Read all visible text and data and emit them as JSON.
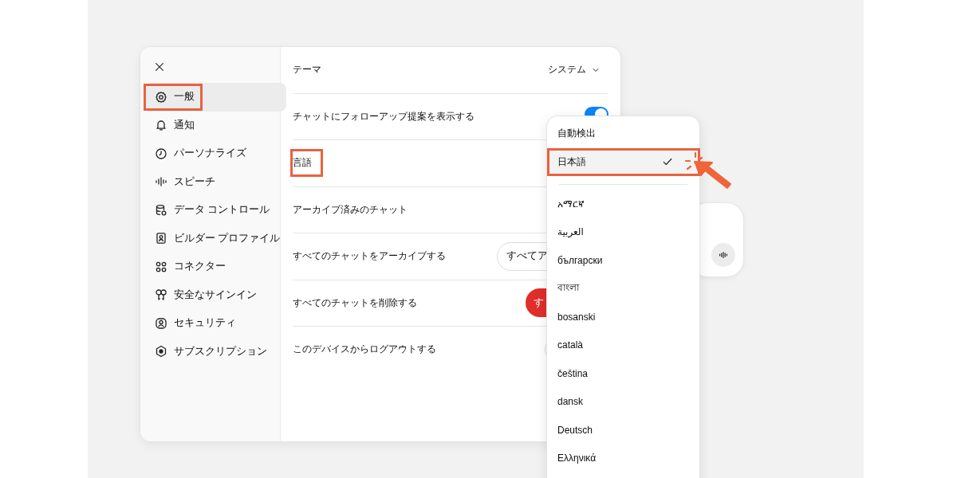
{
  "sidebar": {
    "items": [
      {
        "label": "一般",
        "selected": true,
        "highlighted": true
      },
      {
        "label": "通知",
        "selected": false,
        "highlighted": false
      },
      {
        "label": "パーソナライズ",
        "selected": false,
        "highlighted": false
      },
      {
        "label": "スピーチ",
        "selected": false,
        "highlighted": false
      },
      {
        "label": "データ コントロール",
        "selected": false,
        "highlighted": false
      },
      {
        "label": "ビルダー プロファイル",
        "selected": false,
        "highlighted": false
      },
      {
        "label": "コネクター",
        "selected": false,
        "highlighted": false
      },
      {
        "label": "安全なサインイン",
        "selected": false,
        "highlighted": false
      },
      {
        "label": "セキュリティ",
        "selected": false,
        "highlighted": false
      },
      {
        "label": "サブスクリプション",
        "selected": false,
        "highlighted": false
      }
    ]
  },
  "settings": [
    {
      "kind": "select",
      "label": "テーマ",
      "value": "システム",
      "highlighted": false
    },
    {
      "kind": "toggle",
      "label": "チャットにフォローアップ提案を表示する",
      "on": true,
      "highlighted": false
    },
    {
      "kind": "plain",
      "label": "言語",
      "highlighted": true
    },
    {
      "kind": "plain",
      "label": "アーカイブ済みのチャット",
      "highlighted": false
    },
    {
      "kind": "outline-button",
      "label": "すべてのチャットをアーカイブする",
      "button": "すべてア",
      "highlighted": false
    },
    {
      "kind": "danger-button",
      "label": "すべてのチャットを削除する",
      "button": "す",
      "highlighted": false
    },
    {
      "kind": "hidden-button",
      "label": "このデバイスからログアウトする",
      "highlighted": false
    }
  ],
  "language_menu": {
    "top_options": [
      {
        "label": "自動検出",
        "selected": false,
        "highlighted": false
      },
      {
        "label": "日本語",
        "selected": true,
        "highlighted": true
      }
    ],
    "options": [
      {
        "label": "አማርኛ",
        "selected": false
      },
      {
        "label": "العربية",
        "selected": false
      },
      {
        "label": "български",
        "selected": false
      },
      {
        "label": "বাংলা",
        "selected": false
      },
      {
        "label": "bosanski",
        "selected": false
      },
      {
        "label": "català",
        "selected": false
      },
      {
        "label": "čeština",
        "selected": false
      },
      {
        "label": "dansk",
        "selected": false
      },
      {
        "label": "Deutsch",
        "selected": false
      },
      {
        "label": "Ελληνικά",
        "selected": false
      }
    ]
  }
}
